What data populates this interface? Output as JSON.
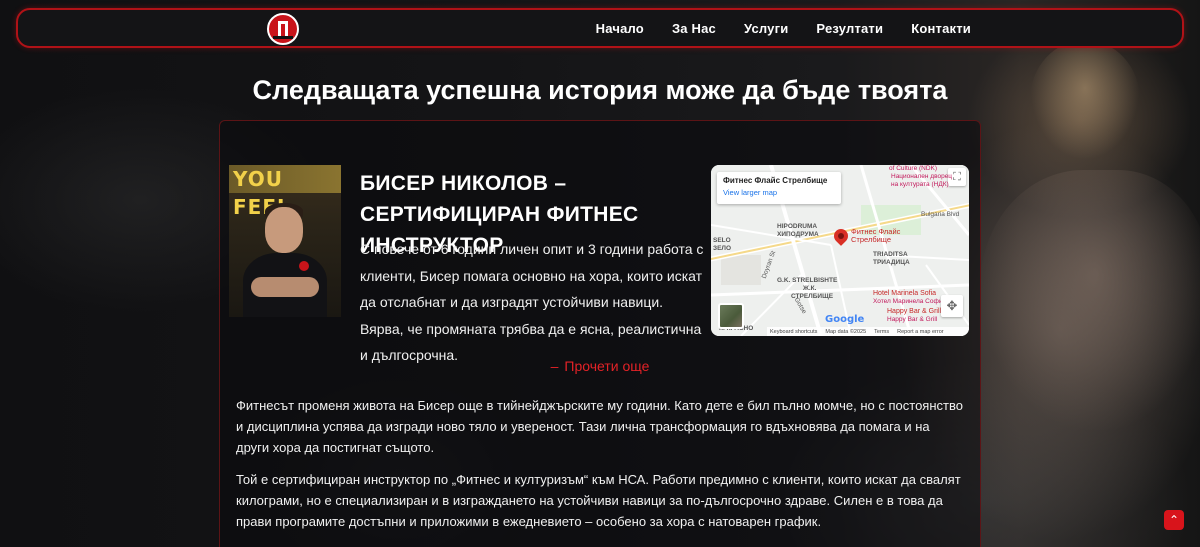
{
  "nav": {
    "items": [
      "Начало",
      "За Нас",
      "Услуги",
      "Резултати",
      "Контакти"
    ]
  },
  "hero": {
    "headline": "Следващата успешна история може да бъде твоята"
  },
  "profile": {
    "photo_banner": "YOU FEEL",
    "name": "Бисер Николов – сертифициран фитнес инструктор",
    "intro": "С повече от 6 години личен опит и 3 години работа с клиенти, Бисер помага основно на хора, които искат да отслабнат и да изградят устойчиви навици. Вярва, че промяната трябва да е ясна, реалистична и дългосрочна.",
    "read_more": "Прочети още"
  },
  "map": {
    "place_title": "Фитнес Флайс Стрелбище",
    "larger_map_link": "View larger map",
    "labels": {
      "culture_en": "of Culture (NDK)",
      "culture_bg": "Национален дворец на културата (НДК)",
      "bulgaria_blvd": "Bulgaria Blvd",
      "hipodruma_en": "HIPODRUMA",
      "hipodruma_bg": "ХИПОДРУМА",
      "selo_en": "SELO",
      "selo_bg": "ЗЕЛО",
      "pin_label": "Фитнес Флайс Стрелбище",
      "triaditsa_en": "TRIADITSA",
      "triaditsa_bg": "ТРИАДИЦА",
      "doyran": "Doyran St",
      "strelbishte_en": "G.K. STRELBISHTE",
      "strelbishte_bg1": "Ж.К.",
      "strelbishte_bg2": "СТРЕЛБИЩЕ",
      "hotel_en": "Hotel Marinela Sofia",
      "hotel_bg": "Хотел Маринела София",
      "happy_en": "Happy Bar & Grill",
      "happy_bg": "Happy Bar & Grill",
      "krasno": "К. КРАСНО",
      "gotse": "Gotse"
    },
    "google_logo": "Google",
    "attribution": {
      "shortcuts": "Keyboard shortcuts",
      "data": "Map data ©2025",
      "terms": "Terms",
      "report": "Report a map error"
    },
    "fullscreen_glyph": "⛶",
    "control_glyph": "✥"
  },
  "story": {
    "p1": "Фитнесът променя живота на Бисер още в тийнейджърските му години. Като дете е бил пълно момче, но с постоянство и дисциплина успява да изгради ново тяло и увереност. Тази лична трансформация го вдъхновява да помага и на други хора да постигнат същото.",
    "p2": "Той е сертифициран инструктор по „Фитнес и културизъм“ към НСА. Работи предимно с клиенти, които искат да свалят килограми, но е специализиран и в изграждането на устойчиви навици за по-дългосрочно здраве. Силен е в това да прави програмите достъпни и приложими в ежедневието – особено за хора с натоварен график."
  },
  "ui": {
    "accent": "#e32227",
    "scroll_top_glyph": "⌃"
  }
}
